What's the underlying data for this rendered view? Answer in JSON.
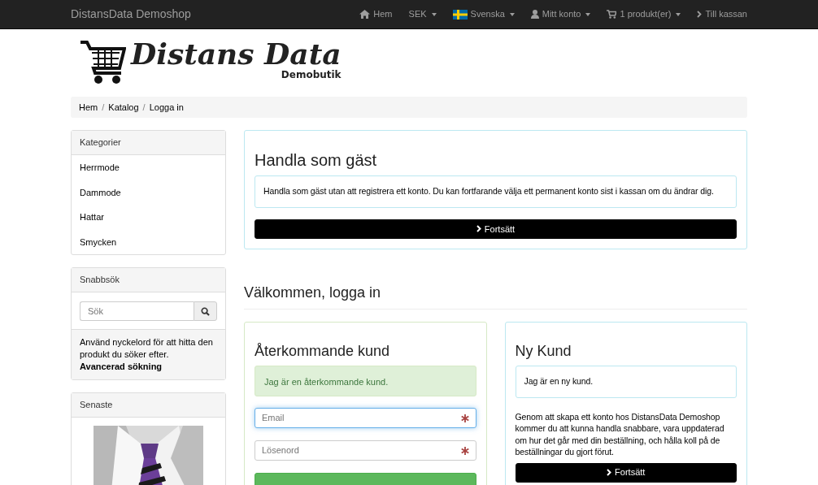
{
  "navbar": {
    "brand": "DistansData Demoshop",
    "items": [
      {
        "kind": "home",
        "label": "Hem",
        "dropdown": false
      },
      {
        "kind": "text",
        "label": "SEK",
        "dropdown": true
      },
      {
        "kind": "flag",
        "label": "Svenska",
        "dropdown": true
      },
      {
        "kind": "user",
        "label": "Mitt konto",
        "dropdown": true
      },
      {
        "kind": "cart",
        "label": "1 produkt(er)",
        "dropdown": true
      },
      {
        "kind": "chevron",
        "label": "Till kassan",
        "dropdown": false
      }
    ]
  },
  "logo": {
    "title": "Distans Data",
    "subtitle": "Demobutik"
  },
  "breadcrumb": [
    "Hem",
    "Katalog",
    "Logga in"
  ],
  "breadcrumb_separator": "/",
  "sidebar": {
    "categories": {
      "title": "Kategorier",
      "items": [
        "Herrmode",
        "Dammode",
        "Hattar",
        "Smycken"
      ]
    },
    "quick_search": {
      "title": "Snabbsök",
      "placeholder": "Sök",
      "help": "Använd nyckelord för att hitta den produkt du söker efter.",
      "advanced_link": "Avancerad sökning"
    },
    "latest": {
      "title": "Senaste"
    }
  },
  "guest": {
    "title": "Handla som gäst",
    "text": "Handla som gäst utan att registrera ett konto. Du kan fortfarande välja ett permanent konto sist i kassan om du ändrar dig.",
    "button": "Fortsätt"
  },
  "login_heading": "Välkommen, logga in",
  "returning": {
    "title": "Återkommande kund",
    "alert": "Jag är en återkommande kund.",
    "fields": [
      {
        "placeholder": "Email",
        "required": true,
        "focused": true
      },
      {
        "placeholder": "Lösenord",
        "required": true,
        "focused": false
      }
    ]
  },
  "new_customer": {
    "title": "Ny Kund",
    "note": "Jag är en ny kund.",
    "text": "Genom att skapa ett konto hos DistansData Demoshop kommer du att kunna handla snabbare, vara uppdaterad om hur det går med din beställning, och hålla koll på de beställningar du gjort förut.",
    "button": "Fortsätt"
  }
}
